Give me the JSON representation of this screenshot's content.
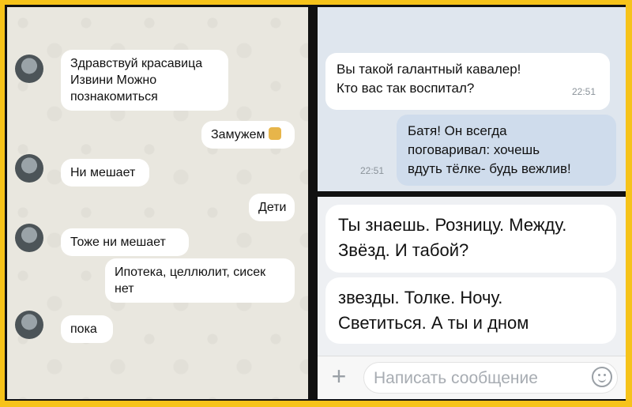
{
  "left_chat": {
    "messages": [
      {
        "text": "Здравствуй красавица\nИзвини Можно\nпознакомиться",
        "dir": "in"
      },
      {
        "text": "Замужем",
        "dir": "out",
        "emoji": "cat-emoji"
      },
      {
        "text": "Ни мешает",
        "dir": "in"
      },
      {
        "text": "Дети",
        "dir": "out"
      },
      {
        "text": "Тоже ни мешает",
        "dir": "in"
      },
      {
        "text": "Ипотека, целлюлит, сисек\nнет",
        "dir": "out"
      },
      {
        "text": "пока",
        "dir": "in"
      }
    ]
  },
  "top_right_chat": {
    "messages": [
      {
        "text": "Вы такой галантный кавалер!\nКто вас так воспитал?",
        "time": "22:51",
        "dir": "in"
      },
      {
        "text": "Батя! Он всегда\nпоговаривал: хочешь\nвдуть тёлке- будь вежлив!",
        "time": "22:51",
        "dir": "out"
      }
    ]
  },
  "bottom_right_chat": {
    "messages": [
      {
        "text": "Ты знаешь. Розницу. Между.\nЗвёзд. И табой?"
      },
      {
        "text": "звезды. Толке. Ночу.\nСветиться. А ты и дном"
      }
    ],
    "composer": {
      "plus_icon": "plus-icon",
      "placeholder": "Написать сообщение",
      "emoji_icon": "smile-icon"
    }
  },
  "colors": {
    "frame": "#f6c31a",
    "border": "#111111",
    "vk_outgoing": "#cfdcec"
  }
}
